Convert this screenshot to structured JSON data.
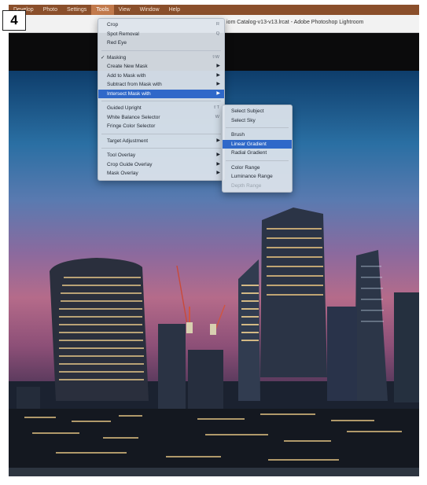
{
  "badge": "4",
  "menubar": {
    "items": [
      "Develop",
      "Photo",
      "Settings",
      "Tools",
      "View",
      "Window",
      "Help"
    ],
    "active": "Tools"
  },
  "window": {
    "title": "iom Catalog-v13-v13.lrcat - Adobe Photoshop Lightroom"
  },
  "tools_menu": {
    "items": [
      {
        "label": "Crop",
        "shortcut": "R",
        "type": "item"
      },
      {
        "label": "Spot Removal",
        "shortcut": "Q",
        "type": "item"
      },
      {
        "label": "Red Eye",
        "shortcut": "",
        "type": "item"
      },
      {
        "type": "separator"
      },
      {
        "label": "Masking",
        "shortcut": "⇧W",
        "type": "item",
        "checked": true
      },
      {
        "label": "Create New Mask",
        "type": "submenu"
      },
      {
        "label": "Add to Mask with",
        "type": "submenu"
      },
      {
        "label": "Subtract from Mask with",
        "type": "submenu"
      },
      {
        "label": "Intersect Mask with",
        "type": "submenu",
        "highlighted": true
      },
      {
        "type": "separator"
      },
      {
        "label": "Guided Upright",
        "shortcut": "⇧T",
        "type": "item"
      },
      {
        "label": "White Balance Selector",
        "shortcut": "W",
        "type": "item"
      },
      {
        "label": "Fringe Color Selector",
        "type": "item"
      },
      {
        "type": "separator"
      },
      {
        "label": "Target Adjustment",
        "type": "submenu"
      },
      {
        "type": "separator"
      },
      {
        "label": "Tool Overlay",
        "type": "submenu"
      },
      {
        "label": "Crop Guide Overlay",
        "type": "submenu"
      },
      {
        "label": "Mask Overlay",
        "type": "submenu"
      }
    ]
  },
  "intersect_submenu": {
    "items": [
      {
        "label": "Select Subject",
        "type": "item"
      },
      {
        "label": "Select Sky",
        "type": "item"
      },
      {
        "type": "separator"
      },
      {
        "label": "Brush",
        "type": "item"
      },
      {
        "label": "Linear Gradient",
        "type": "item",
        "highlighted": true
      },
      {
        "label": "Radial Gradient",
        "type": "item"
      },
      {
        "type": "separator"
      },
      {
        "label": "Color Range",
        "type": "item"
      },
      {
        "label": "Luminance Range",
        "type": "item"
      },
      {
        "label": "Depth Range",
        "type": "item",
        "disabled": true
      }
    ]
  },
  "colors": {
    "menubar_bg": "#8a4f2b",
    "menu_highlight": "#2f68c9",
    "menu_bg": "#dee4ec"
  }
}
